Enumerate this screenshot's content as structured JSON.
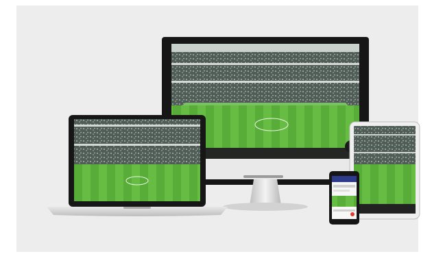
{
  "image": {
    "subject": "stadium",
    "devices": [
      "desktop-monitor",
      "laptop",
      "tablet",
      "smartphone"
    ]
  },
  "colors": {
    "background": "#ededed",
    "device_frame": "#1b1b1b",
    "stand": "#d9d9d9",
    "pitch_light": "#6cc34a",
    "pitch_dark": "#4f9f34",
    "crowd": "#5b6b5b"
  }
}
